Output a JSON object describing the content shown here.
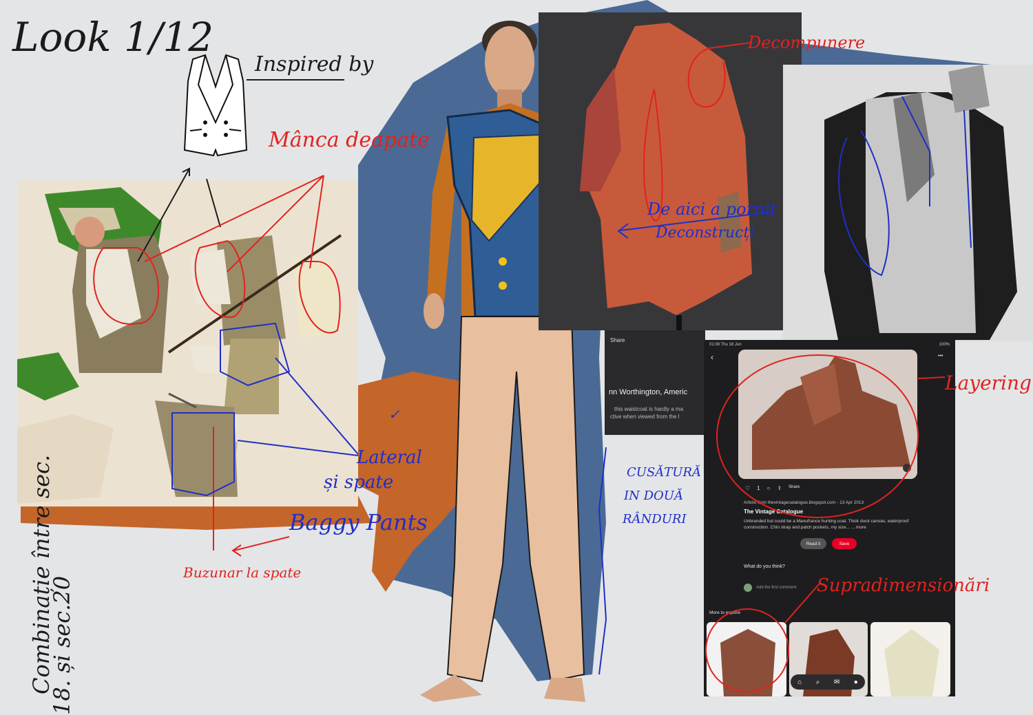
{
  "annotations": {
    "look": "Look 1/12",
    "inspired_by": "Inspired by",
    "sleeve_note": "Mânca deapate",
    "deconstruct_note": "Decompunere",
    "from_here": "De aici a pornit",
    "deconstructions": "Deconstrucți",
    "lateral": "Lateral",
    "si_spate": "și spate",
    "baggy_pants": "Baggy Pants",
    "back_pocket": "Buzunar la spate",
    "seam_1": "CUSĂTURĂ",
    "seam_2": "IN DOUĂ",
    "seam_3": "RÂNDURI",
    "layering": "Layering",
    "oversizing": "Supradimensionări",
    "combination_1": "Combinație între sec.",
    "combination_2": "18. și sec.20",
    "check_mark": "✓"
  },
  "middle_phone": {
    "share": "Share",
    "name": "nn Worthington, Americ",
    "desc_line_1": "this waistcoat is hardly a ma",
    "desc_line_2": "ctive when viewed from the l"
  },
  "pinterest": {
    "time": "01:08 Thu 18 Jun",
    "battery": "100%",
    "back": "‹",
    "more": "•••",
    "likes": "1",
    "share_label": "Share",
    "article_from": "Article from thevintagecatalogue.blogspot.com - 13 Apr 2013",
    "title": "The Vintage Catalogue",
    "description": "Unbranded but could be a Manufrance hunting coat. Thick duck canvas, waterproof construction. Chin strap and patch pockets, my size... ... more",
    "read_it": "Read it",
    "save": "Save",
    "what_do_you_think": "What do you think?",
    "add_comment": "Add the first comment",
    "more_to_explore": "More to explore"
  },
  "colors": {
    "background": "#e4e5e7",
    "brush_blue": "#3d5f8e",
    "brush_orange": "#c4652a",
    "red_annotation": "#e0231e",
    "blue_annotation": "#1f2fc7",
    "pinterest_red": "#e60023"
  }
}
